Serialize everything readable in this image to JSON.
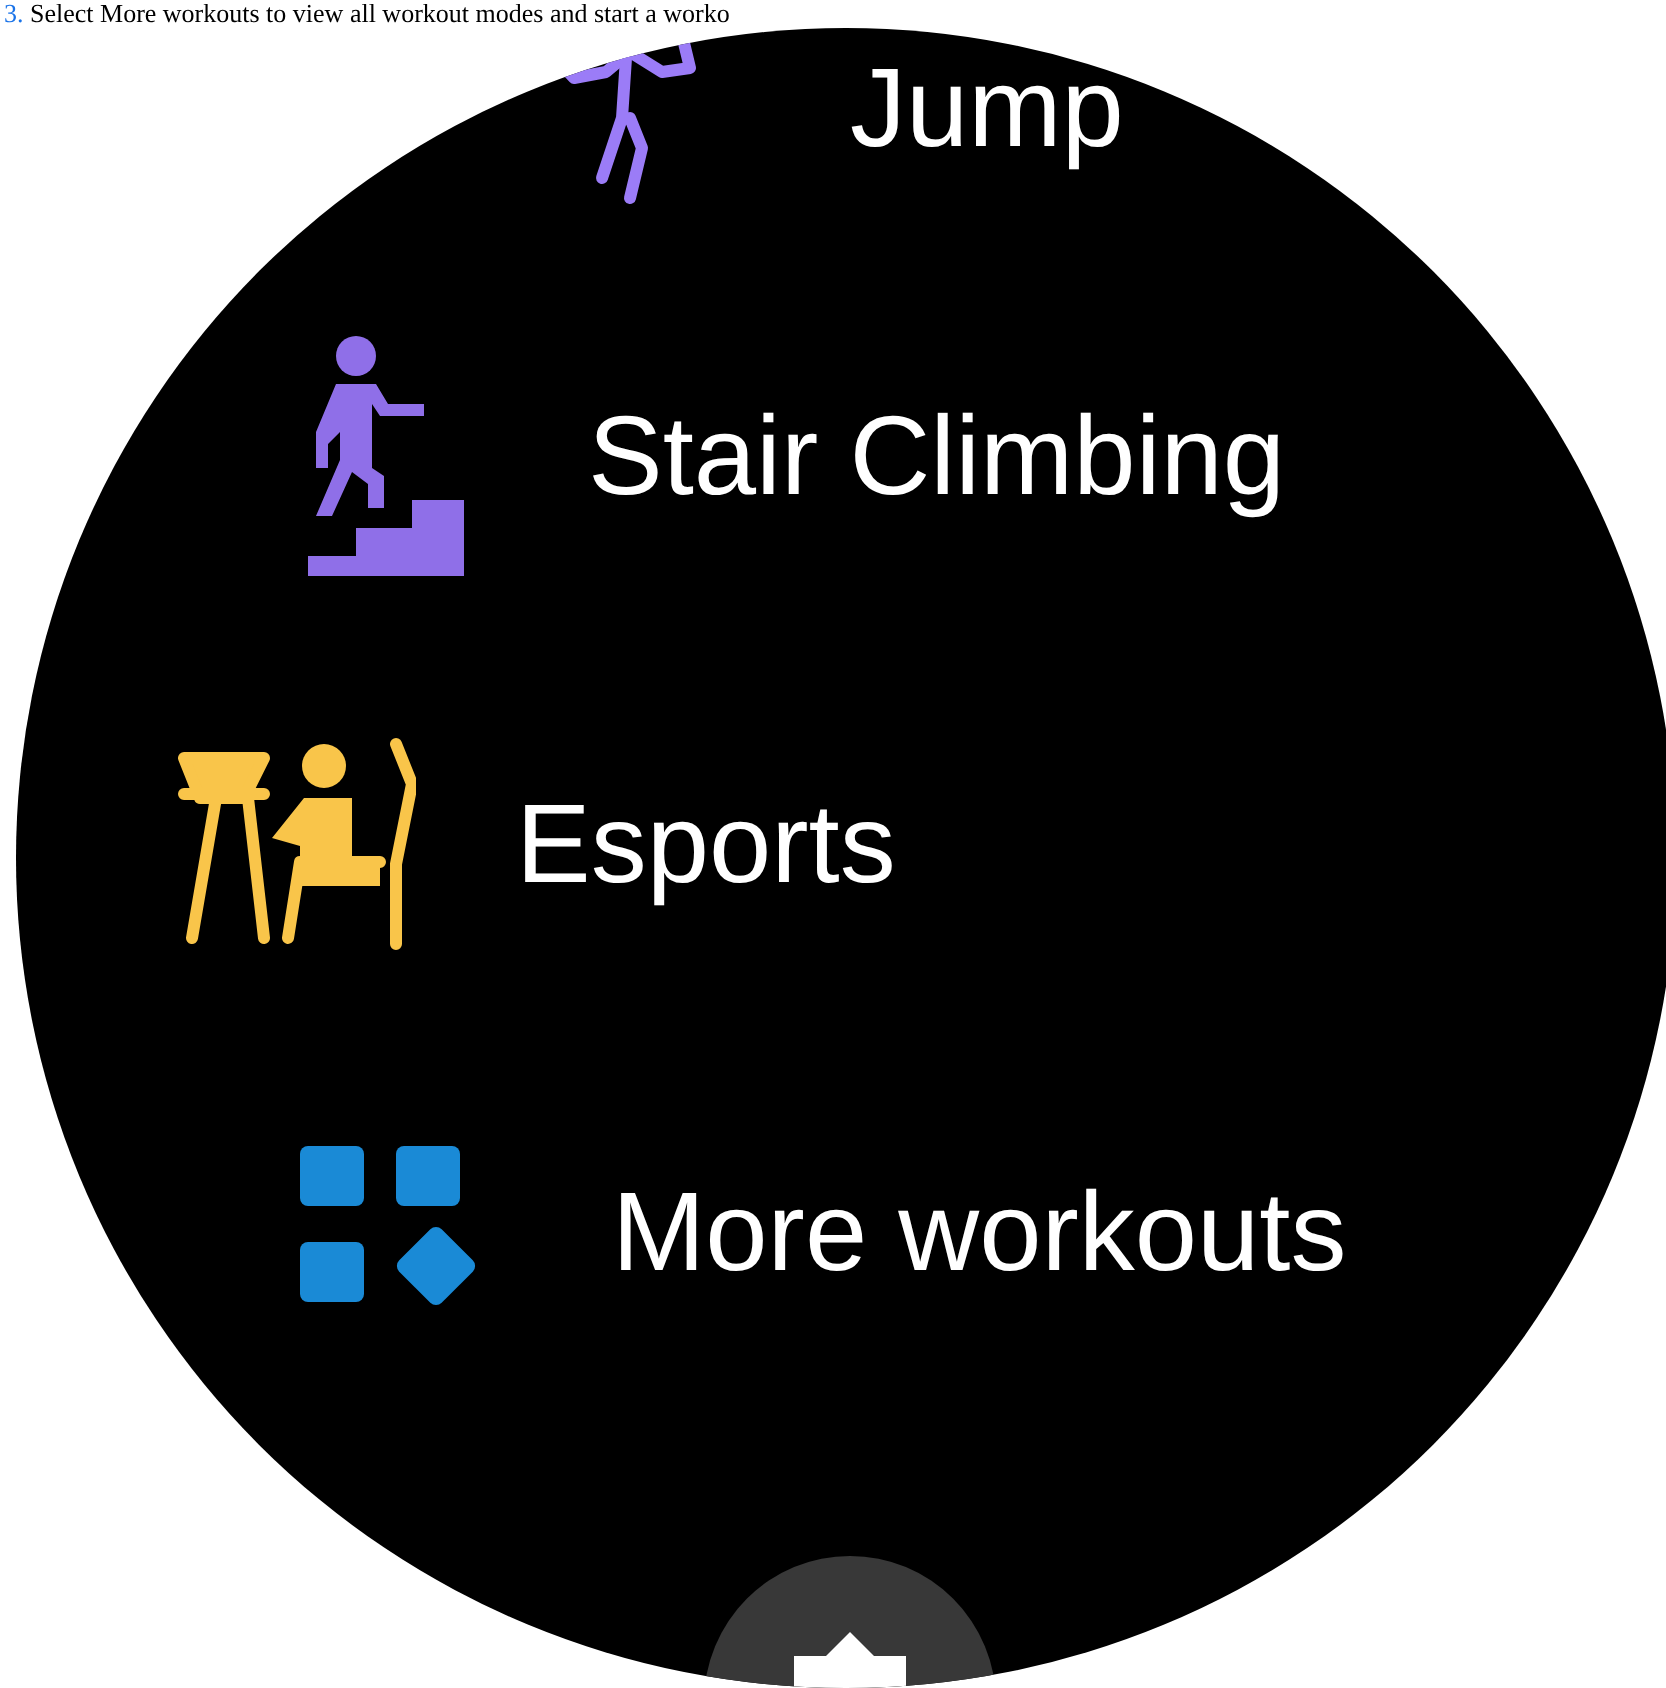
{
  "caption": {
    "step": "3.",
    "text": "Select More workouts to view all workout modes and start a worko"
  },
  "workouts": [
    {
      "kind": "jump-rope",
      "label": "Jump"
    },
    {
      "kind": "stairs",
      "label": "Stair Climbing"
    },
    {
      "kind": "esports",
      "label": "Esports"
    },
    {
      "kind": "more",
      "label": "More workouts"
    }
  ]
}
